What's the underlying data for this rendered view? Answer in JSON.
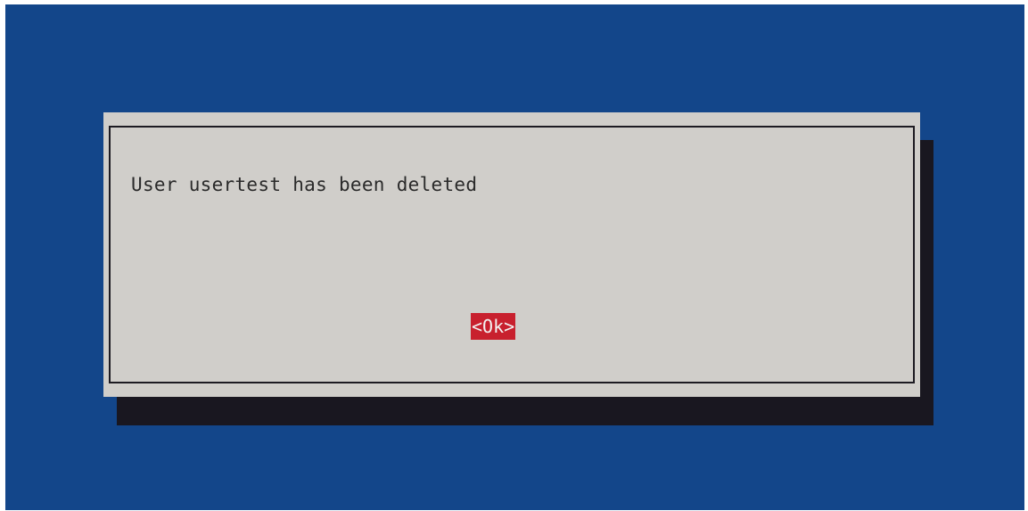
{
  "dialog": {
    "message": "User usertest has been deleted",
    "ok_button_label": "<Ok>"
  },
  "colors": {
    "background": "#13468a",
    "dialog": "#d0ceca",
    "shadow": "#191720",
    "button_focus": "#c8202e"
  }
}
